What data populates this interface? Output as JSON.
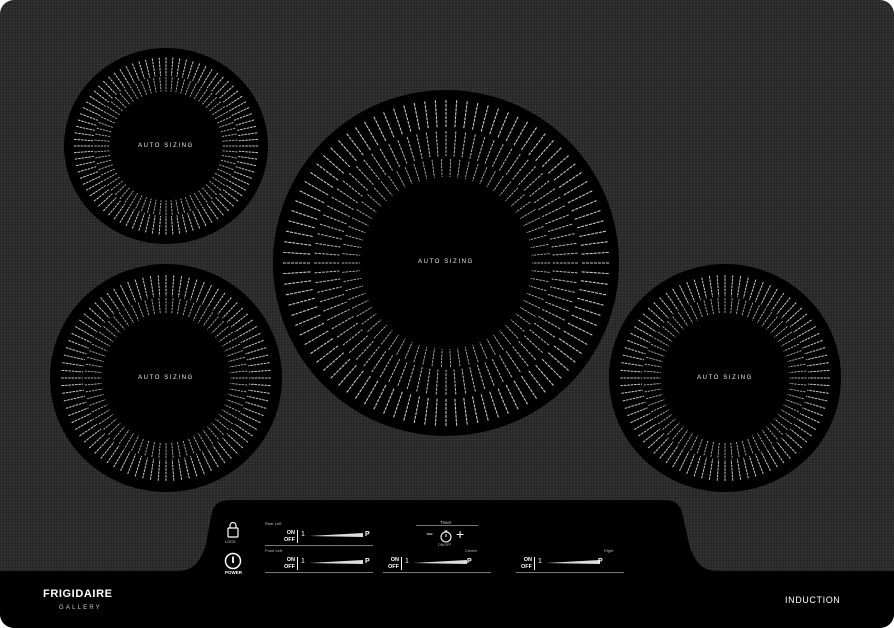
{
  "burners": {
    "rear_left": {
      "label": "AUTO SIZING"
    },
    "center": {
      "label": "AUTO SIZING"
    },
    "front_left": {
      "label": "AUTO SIZING"
    },
    "right": {
      "label": "AUTO SIZING"
    }
  },
  "controls": {
    "lock_label": "LOCK",
    "power_label": "POWER",
    "timer": {
      "label": "Timer",
      "minus": "−",
      "plus": "+",
      "sub": "ON/OFF"
    },
    "zones": [
      {
        "zone_label": "Rear Left",
        "on": "ON",
        "off": "OFF",
        "min": "1",
        "max": "P"
      },
      {
        "zone_label": "Front Left",
        "on": "ON",
        "off": "OFF",
        "min": "1",
        "max": "P"
      },
      {
        "zone_label": "Center",
        "on": "ON",
        "off": "OFF",
        "min": "1",
        "max": "P"
      },
      {
        "zone_label": "Right",
        "on": "ON",
        "off": "OFF",
        "min": "1",
        "max": "P"
      }
    ]
  },
  "branding": {
    "brand": "FRIGIDAIRE",
    "series": "GALLERY",
    "type": "INDUCTION"
  },
  "colors": {
    "glass": "#272727",
    "zone": "#000000",
    "marks": "#e0e0e0",
    "text": "#ffffff"
  }
}
